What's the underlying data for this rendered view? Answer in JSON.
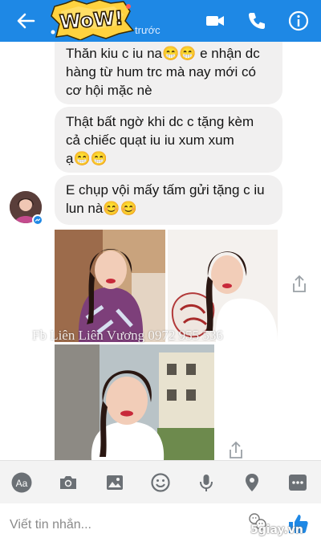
{
  "header": {
    "status": "trước",
    "logo_text": "WOW!",
    "colors": {
      "bar": "#1e88e5"
    },
    "icons": [
      "back-arrow-icon",
      "video-call-icon",
      "phone-icon",
      "info-icon"
    ]
  },
  "messages": [
    {
      "lines": [
        "Thăn kiu c iu na😁😁 e nhận dc",
        "hàng từ hum trc mà nay mới có",
        "cơ hội mặc nè"
      ]
    },
    {
      "lines": [
        "Thật bất ngờ khi dc c tặng kèm",
        "cả chiếc quạt iu iu xum xum",
        "ạ😁😁"
      ]
    },
    {
      "lines": [
        "E chụp vội mấy tấm gửi tặng c iu",
        "lun nà😊😊"
      ]
    }
  ],
  "watermark": "Fb Liên Liên Vương 0972 955 536",
  "toolbar": {
    "aa_label": "Aa",
    "icons": [
      "text-format-icon",
      "camera-icon",
      "image-icon",
      "emoji-icon",
      "microphone-icon",
      "location-icon",
      "more-icon"
    ]
  },
  "composer": {
    "placeholder": "Viết tin nhắn...",
    "value": ""
  },
  "brand": "5giay.vn"
}
